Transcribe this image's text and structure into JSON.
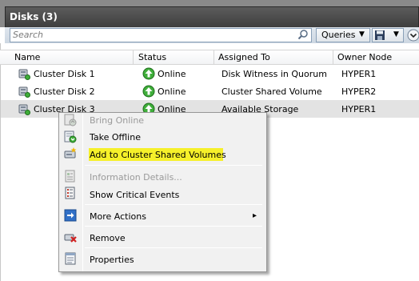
{
  "window": {
    "title": "Disks (3)"
  },
  "toolbar": {
    "search_placeholder": "Search",
    "queries_label": "Queries",
    "dropdown_glyph": "▼",
    "expand_glyph": "⌄"
  },
  "columns": [
    "Name",
    "Status",
    "Assigned To",
    "Owner Node"
  ],
  "rows": [
    {
      "name": "Cluster Disk 1",
      "status": "Online",
      "assigned_to": "Disk Witness in Quorum",
      "owner_node": "HYPER1"
    },
    {
      "name": "Cluster Disk 2",
      "status": "Online",
      "assigned_to": "Cluster Shared Volume",
      "owner_node": "HYPER2"
    },
    {
      "name": "Cluster Disk 3",
      "status": "Online",
      "assigned_to": "Available Storage",
      "owner_node": "HYPER1"
    }
  ],
  "context_menu": {
    "items": [
      {
        "label": "Bring Online",
        "enabled": false,
        "icon": "bring-online-icon"
      },
      {
        "label": "Take Offline",
        "enabled": true,
        "icon": "take-offline-icon"
      },
      {
        "label": "Add to Cluster Shared Volumes",
        "enabled": true,
        "icon": "add-csv-icon",
        "highlighted": true
      },
      {
        "label": "Information Details...",
        "enabled": false,
        "icon": "information-details-icon"
      },
      {
        "label": "Show Critical Events",
        "enabled": true,
        "icon": "critical-events-icon"
      },
      {
        "label": "More Actions",
        "enabled": true,
        "icon": "more-actions-icon",
        "submenu_glyph": "▸"
      },
      {
        "label": "Remove",
        "enabled": true,
        "icon": "remove-icon"
      },
      {
        "label": "Properties",
        "enabled": true,
        "icon": "properties-icon"
      }
    ]
  },
  "colors": {
    "highlight": "#f6f02a",
    "header_bar": "#3e3e3e",
    "status_green": "#3fae3a",
    "selected_row": "#e3e3e3"
  }
}
